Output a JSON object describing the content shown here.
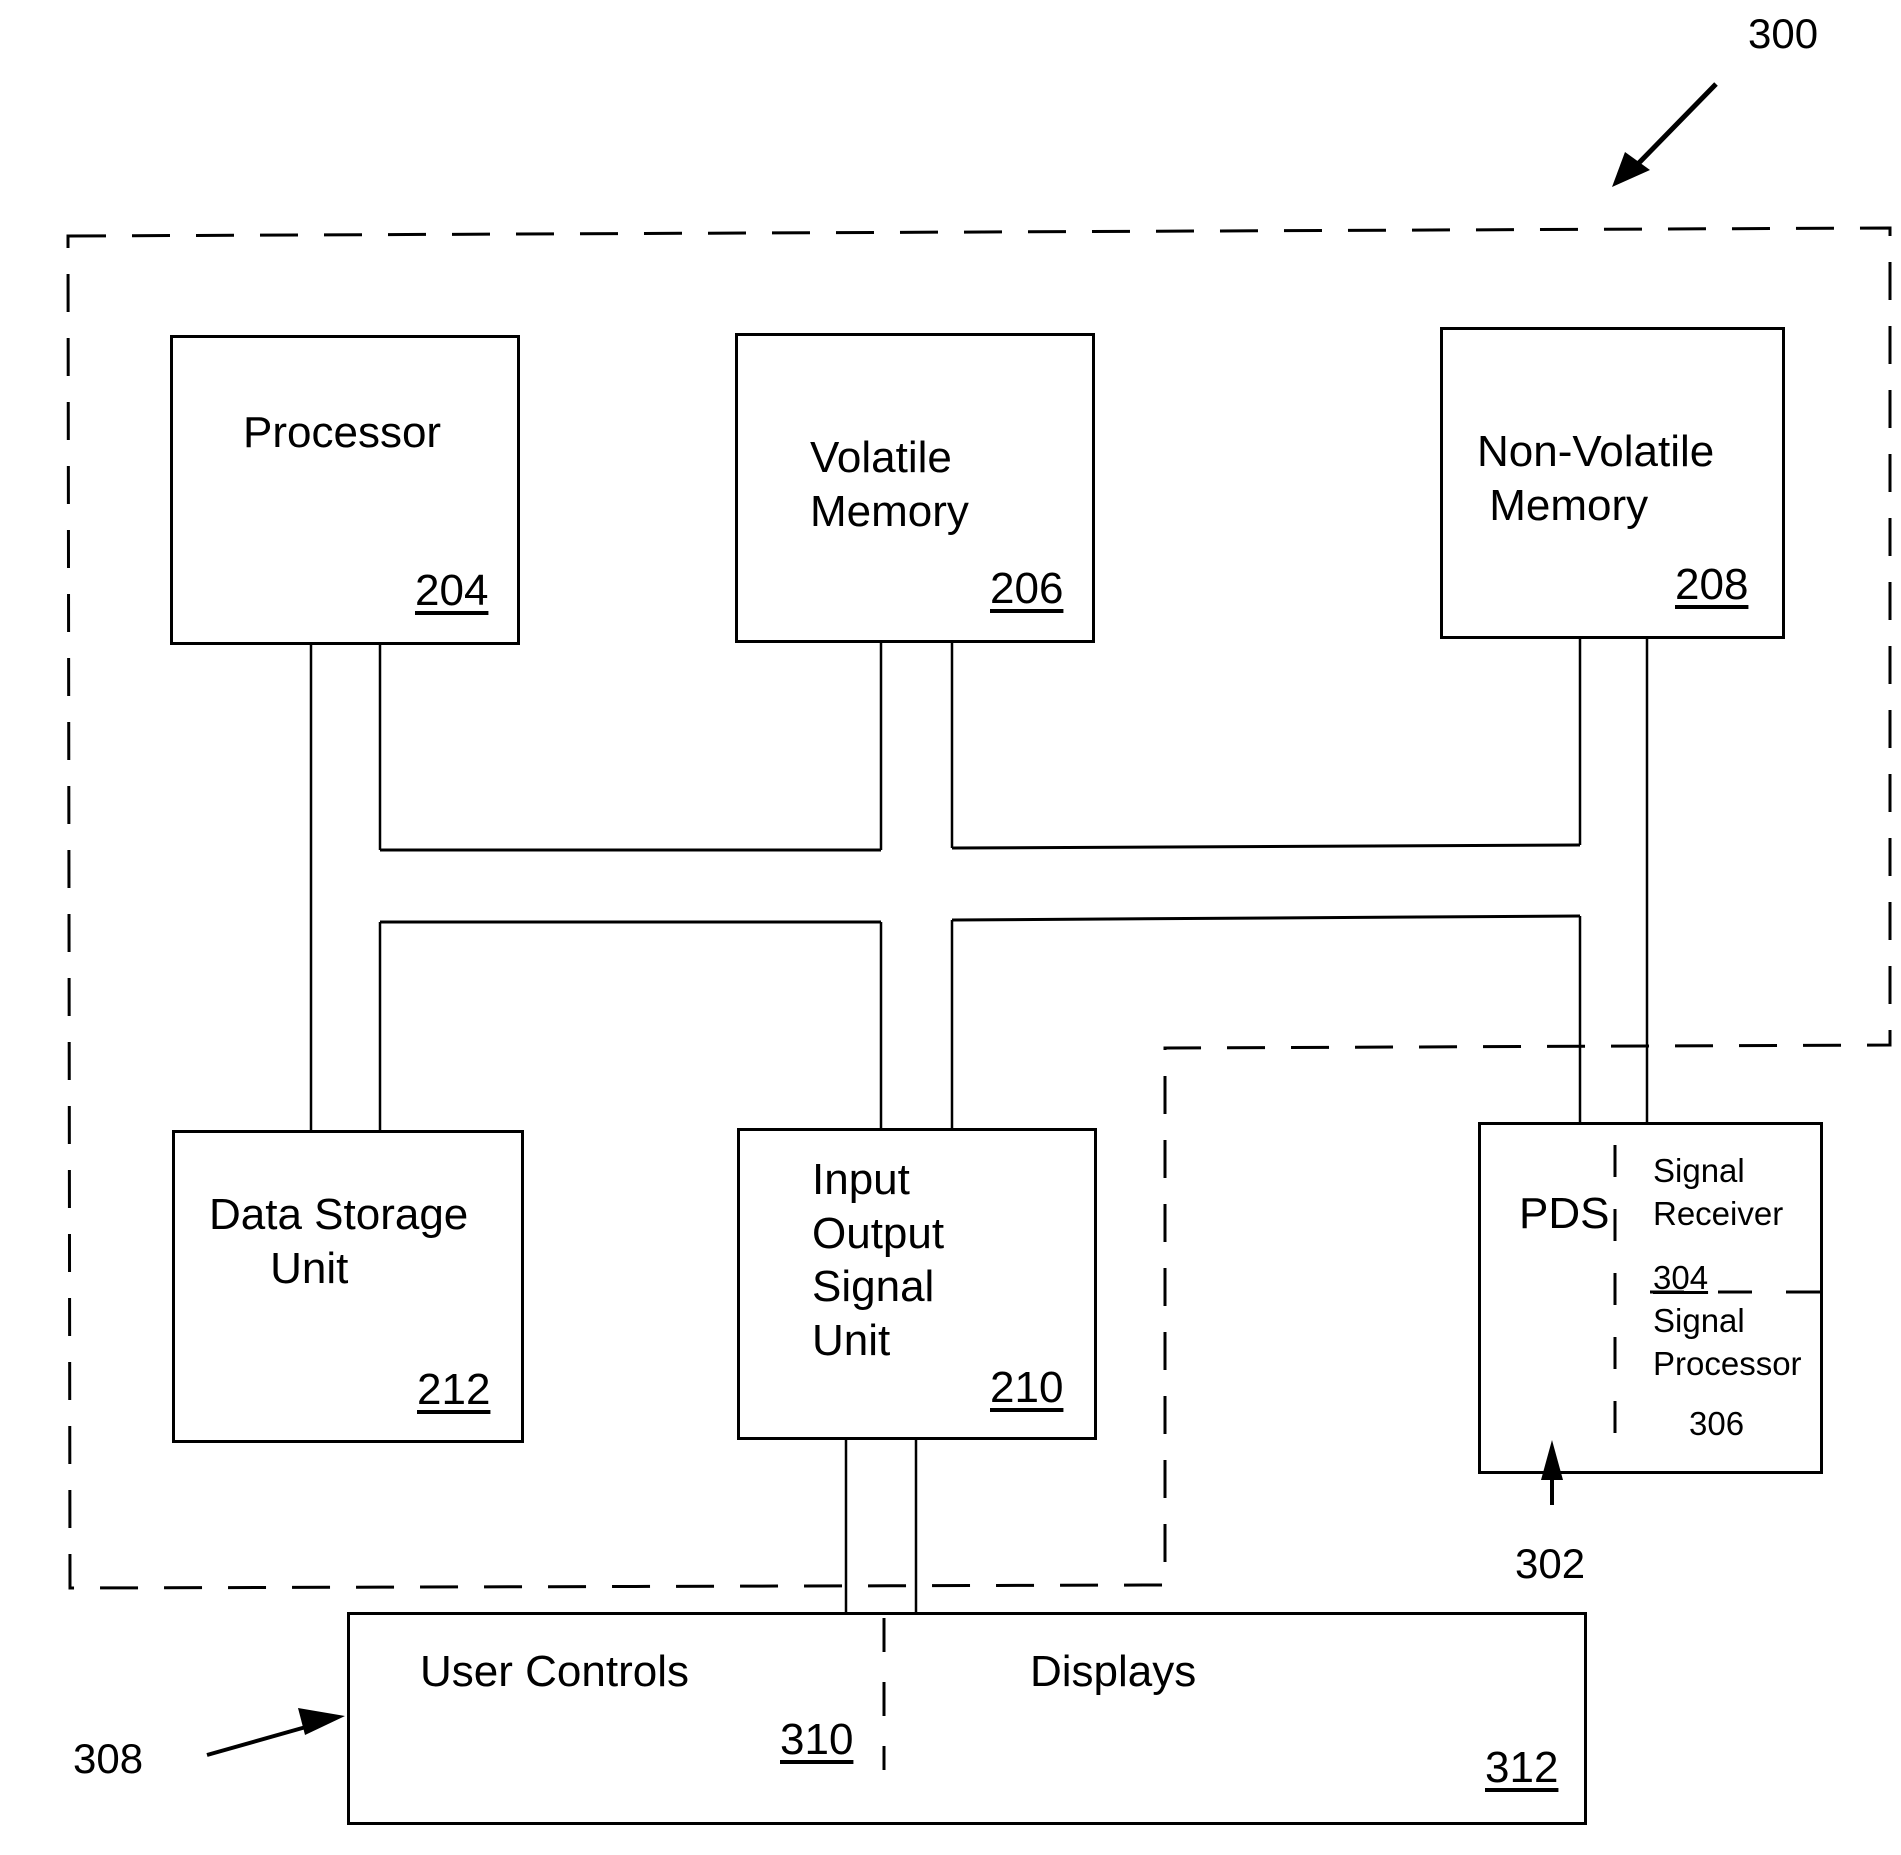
{
  "figure": {
    "system_ref": "300",
    "pds_ref": "302",
    "user_interface_ref": "308"
  },
  "blocks": {
    "processor": {
      "label": "Processor",
      "ref": "204"
    },
    "volatile_memory": {
      "label": "Volatile\nMemory",
      "ref": "206"
    },
    "non_volatile_memory": {
      "label": "Non-Volatile\n Memory",
      "ref": "208"
    },
    "data_storage": {
      "label": "Data Storage\n     Unit",
      "ref": "212"
    },
    "io_signal_unit": {
      "label": "Input\nOutput\nSignal\nUnit",
      "ref": "210"
    },
    "pds": {
      "label": "PDS",
      "signal_receiver": {
        "label": "Signal\nReceiver",
        "ref": "304"
      },
      "signal_processor": {
        "label": "Signal\nProcessor",
        "ref": "306"
      }
    },
    "user_controls": {
      "label": "User Controls",
      "ref": "310"
    },
    "displays": {
      "label": "Displays",
      "ref": "312"
    }
  }
}
